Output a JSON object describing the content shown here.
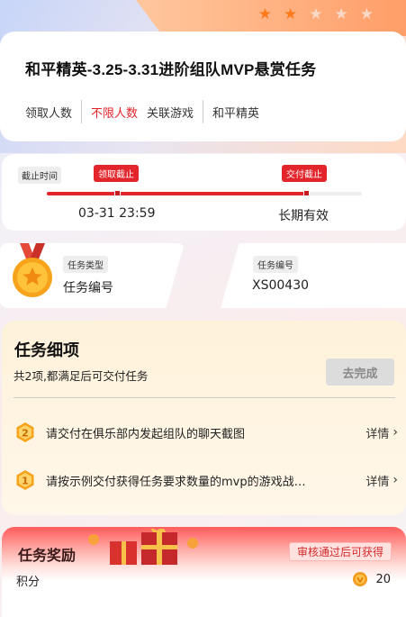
{
  "header": {
    "stars": [
      true,
      true,
      false,
      false,
      false
    ],
    "title": "和平精英-3.25-3.31进阶组队MVP悬赏任务",
    "meta": {
      "claim_label": "领取人数",
      "claim_value": "不限人数",
      "game_label": "关联游戏",
      "game_value": "和平精英"
    }
  },
  "deadline": {
    "label": "截止时间",
    "claim_end_tag": "领取截止",
    "submit_end_tag": "交付截止",
    "claim_end_value": "03-31 23:59",
    "submit_end_value": "长期有效"
  },
  "info": {
    "type_label": "任务类型",
    "type_value": "任务编号",
    "number_label": "任务编号",
    "number_value": "XS00430"
  },
  "details": {
    "title": "任务细项",
    "subtitle": "共2项,都满足后可交付任务",
    "button": "去完成",
    "items": [
      {
        "index": "2",
        "text": "请交付在俱乐部内发起组队的聊天截图",
        "link": "详情"
      },
      {
        "index": "1",
        "text": "请按示例交付获得任务要求数量的mvp的游戏战…",
        "link": "详情"
      }
    ]
  },
  "reward": {
    "title": "任务奖励",
    "tag": "审核通过后可获得",
    "label": "积分",
    "value": "20"
  },
  "colors": {
    "accent_red": "#e3242b",
    "star_on": "#ff7a1a",
    "star_off": "#f8d9c8"
  }
}
